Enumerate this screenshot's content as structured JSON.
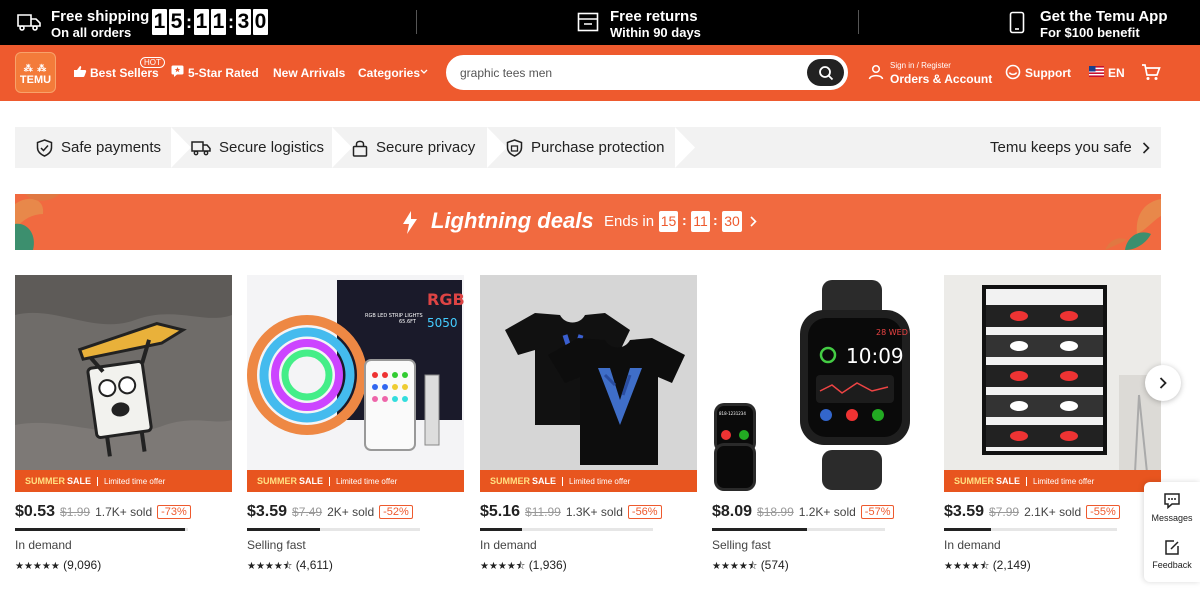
{
  "topbar": {
    "shipping_title": "Free shipping",
    "shipping_sub": "On all orders",
    "timer": [
      "1",
      "5",
      "1",
      "1",
      "3",
      "0"
    ],
    "returns_title": "Free returns",
    "returns_sub": "Within 90 days",
    "app_title": "Get the Temu App",
    "app_sub": "For $100 benefit"
  },
  "nav": {
    "logo": "TEMU",
    "best_sellers": "Best Sellers",
    "hot": "HOT",
    "five_star": "5-Star Rated",
    "new_arrivals": "New Arrivals",
    "categories": "Categories",
    "search_value": "graphic tees men",
    "signin": "Sign in / Register",
    "orders": "Orders & Account",
    "support": "Support",
    "lang": "EN"
  },
  "safe": {
    "payments": "Safe payments",
    "logistics": "Secure logistics",
    "privacy": "Secure privacy",
    "protection": "Purchase protection",
    "keeps_safe": "Temu keeps you safe"
  },
  "deals": {
    "title": "Lightning deals",
    "ends_in": "Ends in",
    "hh": "15",
    "mm": "11",
    "ss": "30"
  },
  "sale_label": {
    "summer": "SUMMER",
    "sale": "SALE",
    "limited": "Limited time offer"
  },
  "products": [
    {
      "price": "$0.53",
      "old": "$1.99",
      "sold": "1.7K+ sold",
      "disc": "-73%",
      "status": "In demand",
      "stars": "★★★★★",
      "reviews": "(9,096)",
      "progress": 0.98
    },
    {
      "price": "$3.59",
      "old": "$7.49",
      "sold": "2K+ sold",
      "disc": "-52%",
      "status": "Selling fast",
      "stars": "★★★★⯪",
      "reviews": "(4,611)",
      "progress": 0.42
    },
    {
      "price": "$5.16",
      "old": "$11.99",
      "sold": "1.3K+ sold",
      "disc": "-56%",
      "status": "In demand",
      "stars": "★★★★⯪",
      "reviews": "(1,936)",
      "progress": 0.24
    },
    {
      "price": "$8.09",
      "old": "$18.99",
      "sold": "1.2K+ sold",
      "disc": "-57%",
      "status": "Selling fast",
      "stars": "★★★★⯪",
      "reviews": "(574)",
      "progress": 0.55
    },
    {
      "price": "$3.59",
      "old": "$7.99",
      "sold": "2.1K+ sold",
      "disc": "-55%",
      "status": "In demand",
      "stars": "★★★★⯪",
      "reviews": "(2,149)",
      "progress": 0.27
    }
  ],
  "product_images": {
    "p1_text": "",
    "p2_label": "RGB LED STRIP LIGHTS",
    "p2_rgb": "RGB",
    "p2_5050": "5050",
    "p2_len": "65.6FT",
    "watch_time": "10:09",
    "watch_date": "28 WED",
    "watch_phone": "818-1231234"
  },
  "side": {
    "messages": "Messages",
    "feedback": "Feedback"
  },
  "colors": {
    "brand": "#ee5a2e",
    "deals_bg": "#f16a40"
  }
}
